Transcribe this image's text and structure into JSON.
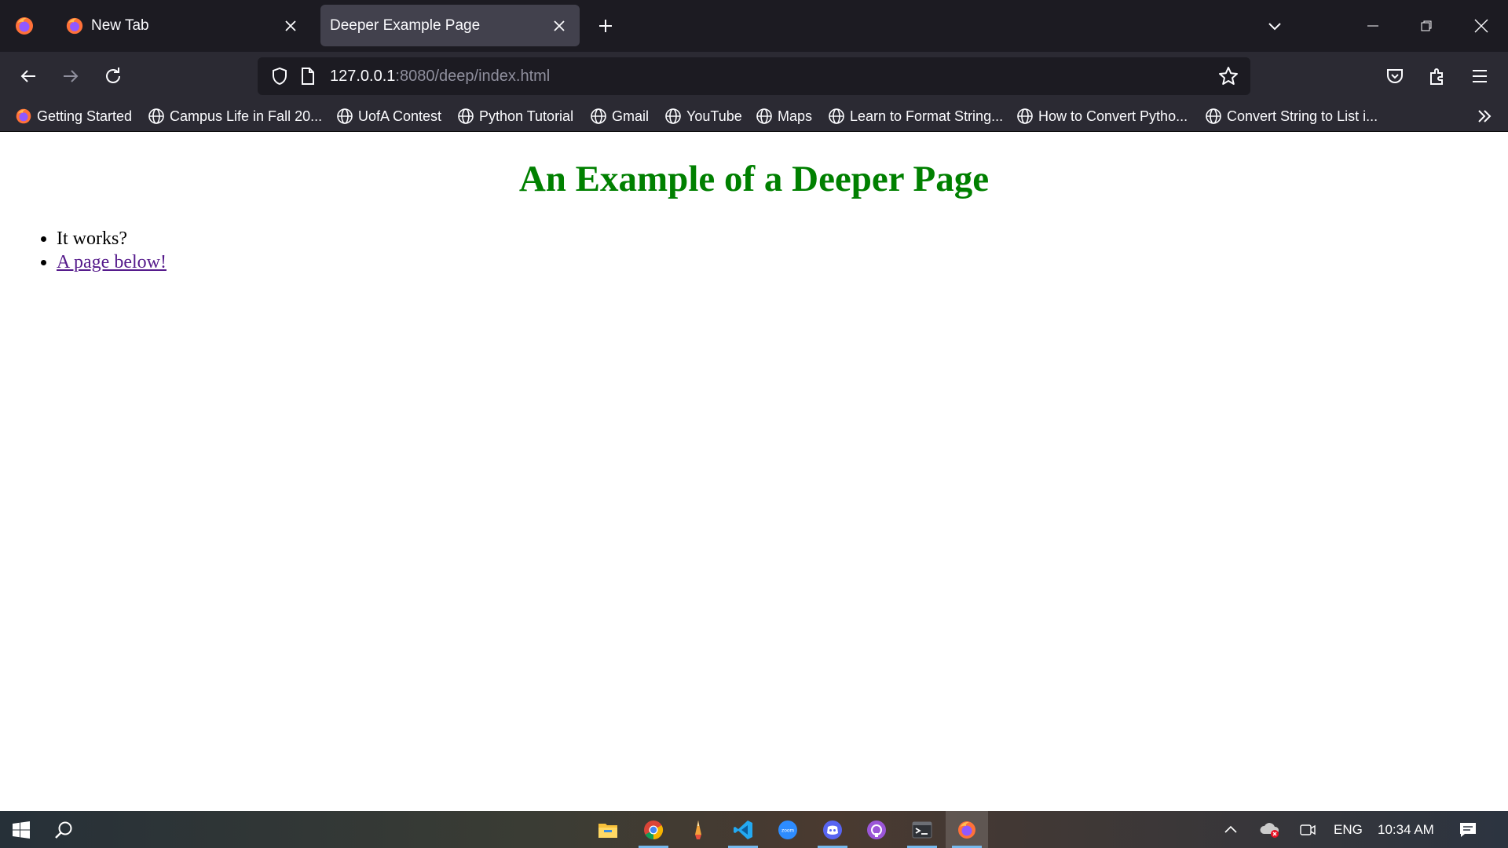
{
  "browser": {
    "tabs": [
      {
        "title": "New Tab",
        "icon": "firefox-icon",
        "active": false
      },
      {
        "title": "Deeper Example Page",
        "icon": "none",
        "active": true
      }
    ],
    "url": {
      "host": "127.0.0.1",
      "path": ":8080/deep/index.html"
    },
    "bookmarks": [
      {
        "label": "Getting Started",
        "icon": "firefox-icon"
      },
      {
        "label": "Campus Life in Fall 20...",
        "icon": "globe-icon"
      },
      {
        "label": "UofA Contest",
        "icon": "globe-icon"
      },
      {
        "label": "Python Tutorial",
        "icon": "globe-icon"
      },
      {
        "label": "Gmail",
        "icon": "globe-icon"
      },
      {
        "label": "YouTube",
        "icon": "globe-icon"
      },
      {
        "label": "Maps",
        "icon": "globe-icon"
      },
      {
        "label": "Learn to Format String...",
        "icon": "globe-icon"
      },
      {
        "label": "How to Convert Pytho...",
        "icon": "globe-icon"
      },
      {
        "label": "Convert String to List i...",
        "icon": "globe-icon"
      }
    ]
  },
  "page": {
    "heading": "An Example of a Deeper Page",
    "items": [
      {
        "text": "It works?",
        "link": false
      },
      {
        "text": "A page below!",
        "link": true
      }
    ]
  },
  "taskbar": {
    "apps": [
      "file-explorer-icon",
      "chrome-icon",
      "paint-icon",
      "vscode-icon",
      "zoom-icon",
      "discord-icon",
      "github-desktop-icon",
      "terminal-icon",
      "firefox-icon"
    ],
    "language": "ENG",
    "time": "10:34 AM"
  },
  "colors": {
    "heading": "#008000",
    "link": "#551a8b",
    "tab_bar": "#1c1b22",
    "toolbar": "#2b2a33"
  }
}
